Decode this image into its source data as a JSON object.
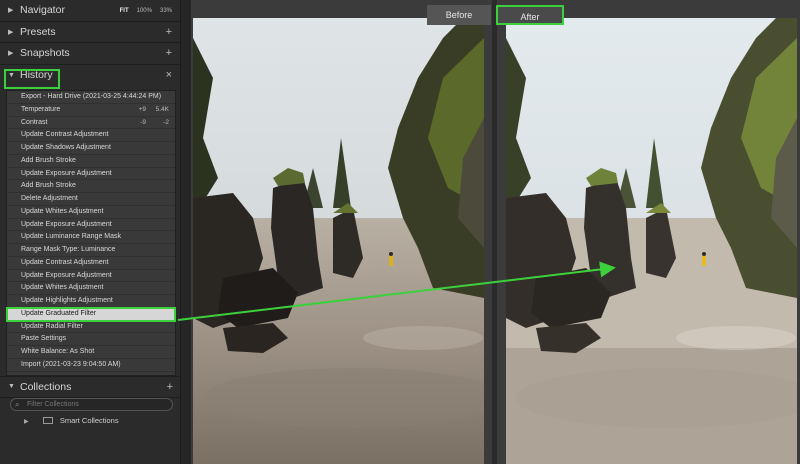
{
  "left_panel": {
    "navigator": {
      "title": "Navigator",
      "fit": "FIT",
      "zoom1": "100%",
      "zoom2": "33%"
    },
    "presets": {
      "title": "Presets",
      "action": "+"
    },
    "snapshots": {
      "title": "Snapshots",
      "action": "+"
    },
    "history": {
      "title": "History",
      "action": "×",
      "items": [
        {
          "label": "Export - Hard Drive (2021-03-25 4:44:24 PM)",
          "v1": "",
          "v2": ""
        },
        {
          "label": "Temperature",
          "v1": "+9",
          "v2": "5.4K"
        },
        {
          "label": "Contrast",
          "v1": "-9",
          "v2": "-2"
        },
        {
          "label": "Update Contrast Adjustment",
          "v1": "",
          "v2": ""
        },
        {
          "label": "Update Shadows Adjustment",
          "v1": "",
          "v2": ""
        },
        {
          "label": "Add Brush Stroke",
          "v1": "",
          "v2": ""
        },
        {
          "label": "Update Exposure Adjustment",
          "v1": "",
          "v2": ""
        },
        {
          "label": "Add Brush Stroke",
          "v1": "",
          "v2": ""
        },
        {
          "label": "Delete Adjustment",
          "v1": "",
          "v2": ""
        },
        {
          "label": "Update Whites Adjustment",
          "v1": "",
          "v2": ""
        },
        {
          "label": "Update Exposure Adjustment",
          "v1": "",
          "v2": ""
        },
        {
          "label": "Update Luminance Range Mask",
          "v1": "",
          "v2": ""
        },
        {
          "label": "Range Mask Type: Luminance",
          "v1": "",
          "v2": ""
        },
        {
          "label": "Update Contrast Adjustment",
          "v1": "",
          "v2": ""
        },
        {
          "label": "Update Exposure Adjustment",
          "v1": "",
          "v2": ""
        },
        {
          "label": "Update Whites Adjustment",
          "v1": "",
          "v2": ""
        },
        {
          "label": "Update Highlights Adjustment",
          "v1": "",
          "v2": ""
        },
        {
          "label": "Update Graduated Filter",
          "v1": "",
          "v2": "",
          "selected": true
        },
        {
          "label": "Update Radial Filter",
          "v1": "",
          "v2": ""
        },
        {
          "label": "Paste Settings",
          "v1": "",
          "v2": ""
        },
        {
          "label": "White Balance: As Shot",
          "v1": "",
          "v2": ""
        },
        {
          "label": "Import (2021-03-23 9:04:50 AM)",
          "v1": "",
          "v2": ""
        }
      ]
    },
    "collections": {
      "title": "Collections",
      "action": "+",
      "filter_placeholder": "Filter Collections",
      "smart_collections": "Smart Collections"
    }
  },
  "view": {
    "before_label": "Before",
    "after_label": "After"
  },
  "colors": {
    "highlight": "#3cd13c",
    "panel_bg": "#2b2b2b",
    "list_bg": "#393939",
    "selected_bg": "#d6d6d6"
  },
  "icons": [
    "triangle-right-icon",
    "triangle-down-icon",
    "plus-icon",
    "close-icon",
    "search-icon",
    "folder-icon"
  ]
}
